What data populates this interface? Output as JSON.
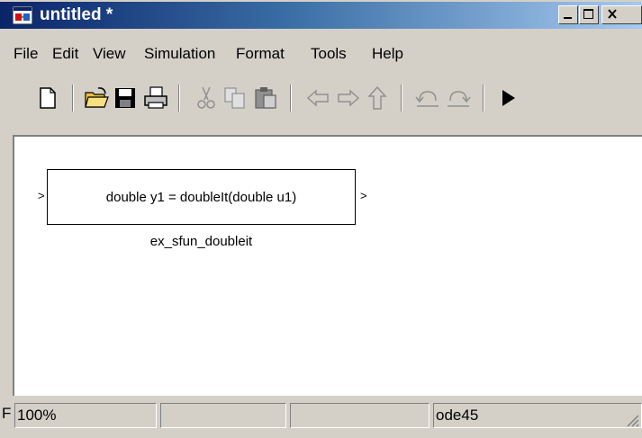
{
  "window": {
    "title": "untitled *"
  },
  "menu": [
    "File",
    "Edit",
    "View",
    "Simulation",
    "Format",
    "Tools",
    "Help"
  ],
  "toolbar": {
    "buttons": [
      "new-model",
      "open",
      "save",
      "print",
      "cut",
      "copy",
      "paste",
      "back",
      "forward",
      "up",
      "undo",
      "redo",
      "start-simulation"
    ]
  },
  "diagram": {
    "block": {
      "signature": "double y1 = doubleIt(double u1)",
      "name": "ex_sfun_doubleit",
      "input_port": ">",
      "output_port": ">"
    }
  },
  "status": {
    "left_clip": "F",
    "zoom": "100%",
    "cell2": "",
    "cell3": "",
    "solver": "ode45"
  }
}
